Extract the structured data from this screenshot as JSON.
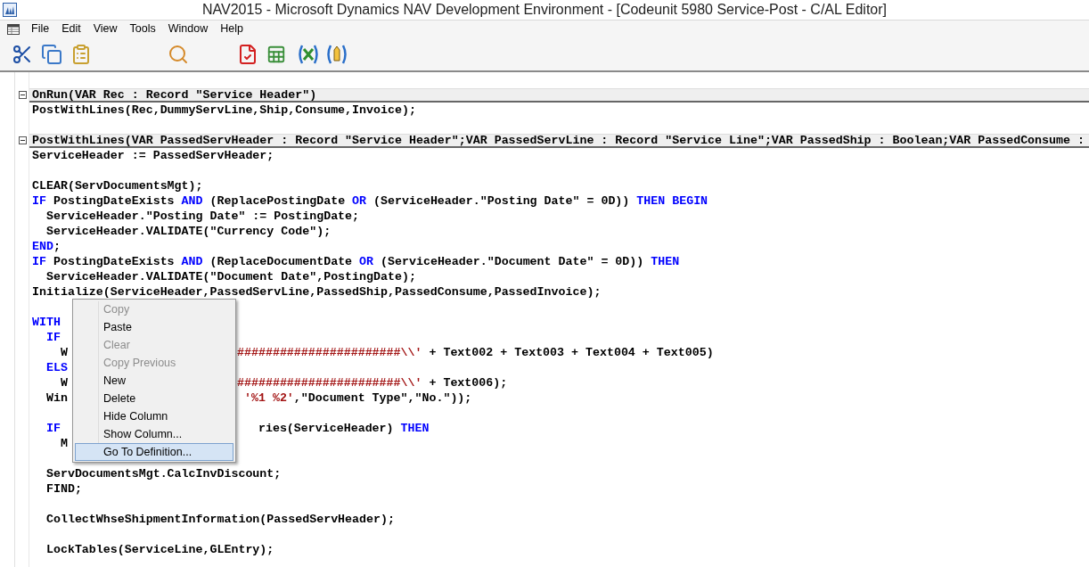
{
  "window": {
    "title": "NAV2015 - Microsoft Dynamics NAV Development Environment - [Codeunit 5980 Service-Post - C/AL Editor]"
  },
  "menu_bar": [
    "File",
    "Edit",
    "View",
    "Tools",
    "Window",
    "Help"
  ],
  "editor": {
    "lines": [
      {
        "kind": "header",
        "expanded": true,
        "text": "OnRun(VAR Rec : Record \"Service Header\")"
      },
      {
        "kind": "code",
        "parts": [
          {
            "kind": "plain",
            "text": "PostWithLines(Rec,DummyServLine,Ship,Consume,Invoice);"
          }
        ]
      },
      {
        "kind": "blank"
      },
      {
        "kind": "header",
        "expanded": true,
        "text": "PostWithLines(VAR PassedServHeader : Record \"Service Header\";VAR PassedServLine : Record \"Service Line\";VAR PassedShip : Boolean;VAR PassedConsume :"
      },
      {
        "kind": "code",
        "parts": [
          {
            "kind": "plain",
            "text": "ServiceHeader := PassedServHeader;"
          }
        ]
      },
      {
        "kind": "blank"
      },
      {
        "kind": "code",
        "parts": [
          {
            "kind": "plain",
            "text": "CLEAR(ServDocumentsMgt);"
          }
        ]
      },
      {
        "kind": "code",
        "parts": [
          {
            "kind": "keyword",
            "text": "IF"
          },
          {
            "kind": "plain",
            "text": " PostingDateExists "
          },
          {
            "kind": "keyword",
            "text": "AND"
          },
          {
            "kind": "plain",
            "text": " (ReplacePostingDate "
          },
          {
            "kind": "keyword",
            "text": "OR"
          },
          {
            "kind": "plain",
            "text": " (ServiceHeader.\"Posting Date\" = 0D)) "
          },
          {
            "kind": "keyword",
            "text": "THEN BEGIN"
          }
        ]
      },
      {
        "kind": "code",
        "parts": [
          {
            "kind": "plain",
            "text": "  ServiceHeader.\"Posting Date\" := PostingDate;"
          }
        ]
      },
      {
        "kind": "code",
        "parts": [
          {
            "kind": "plain",
            "text": "  ServiceHeader.VALIDATE(\"Currency Code\");"
          }
        ]
      },
      {
        "kind": "code",
        "parts": [
          {
            "kind": "keyword",
            "text": "END"
          },
          {
            "kind": "plain",
            "text": ";"
          }
        ]
      },
      {
        "kind": "code",
        "parts": [
          {
            "kind": "keyword",
            "text": "IF"
          },
          {
            "kind": "plain",
            "text": " PostingDateExists "
          },
          {
            "kind": "keyword",
            "text": "AND"
          },
          {
            "kind": "plain",
            "text": " (ReplaceDocumentDate "
          },
          {
            "kind": "keyword",
            "text": "OR"
          },
          {
            "kind": "plain",
            "text": " (ServiceHeader.\"Document Date\" = 0D)) "
          },
          {
            "kind": "keyword",
            "text": "THEN"
          }
        ]
      },
      {
        "kind": "code",
        "parts": [
          {
            "kind": "plain",
            "text": "  ServiceHeader.VALIDATE(\"Document Date\",PostingDate);"
          }
        ]
      },
      {
        "kind": "code",
        "parts": [
          {
            "kind": "plain",
            "text": "Initialize(ServiceHeader,PassedServLine,PassedShip,PassedConsume,PassedInvoice);"
          }
        ]
      },
      {
        "kind": "blank"
      },
      {
        "kind": "code",
        "parts": [
          {
            "kind": "keyword",
            "text": "WITH"
          }
        ]
      },
      {
        "kind": "code",
        "parts": [
          {
            "kind": "keyword",
            "text": "  IF"
          }
        ]
      },
      {
        "kind": "code",
        "parts": [
          {
            "kind": "plain",
            "text": "    W"
          }
        ],
        "after_menu": [
          {
            "kind": "string",
            "text": "#######################\\\\'"
          },
          {
            "kind": "plain",
            "text": " + Text002 + Text003 + Text004 + Text005)"
          }
        ]
      },
      {
        "kind": "code",
        "parts": [
          {
            "kind": "keyword",
            "text": "  ELS"
          }
        ]
      },
      {
        "kind": "code",
        "parts": [
          {
            "kind": "plain",
            "text": "    W"
          }
        ],
        "after_menu": [
          {
            "kind": "string",
            "text": "#######################\\\\'"
          },
          {
            "kind": "plain",
            "text": " + Text006);"
          }
        ]
      },
      {
        "kind": "code",
        "parts": [
          {
            "kind": "plain",
            "text": "  Win"
          }
        ],
        "after_menu": [
          {
            "kind": "string",
            "text": " '%1 %2'"
          },
          {
            "kind": "plain",
            "text": ",\"Document Type\",\"No.\"));"
          }
        ]
      },
      {
        "kind": "blank"
      },
      {
        "kind": "code",
        "parts": [
          {
            "kind": "keyword",
            "text": "  IF"
          }
        ],
        "after_menu": [
          {
            "kind": "plain",
            "text": "   ries(ServiceHeader) "
          },
          {
            "kind": "keyword",
            "text": "THEN"
          }
        ]
      },
      {
        "kind": "code",
        "parts": [
          {
            "kind": "plain",
            "text": "    M"
          }
        ]
      },
      {
        "kind": "blank"
      },
      {
        "kind": "code",
        "parts": [
          {
            "kind": "plain",
            "text": "  ServDocumentsMgt.CalcInvDiscount;"
          }
        ]
      },
      {
        "kind": "code",
        "parts": [
          {
            "kind": "plain",
            "text": "  FIND;"
          }
        ]
      },
      {
        "kind": "blank"
      },
      {
        "kind": "code",
        "parts": [
          {
            "kind": "plain",
            "text": "  CollectWhseShipmentInformation(PassedServHeader);"
          }
        ]
      },
      {
        "kind": "blank"
      },
      {
        "kind": "code",
        "parts": [
          {
            "kind": "plain",
            "text": "  LockTables(ServiceLine,GLEntry);"
          }
        ]
      }
    ]
  },
  "context_menu": [
    {
      "label": "Copy",
      "disabled": true,
      "selected": false
    },
    {
      "label": "Paste",
      "disabled": false,
      "selected": false
    },
    {
      "label": "Clear",
      "disabled": true,
      "selected": false
    },
    {
      "label": "Copy Previous",
      "disabled": true,
      "selected": false
    },
    {
      "label": "New",
      "disabled": false,
      "selected": false
    },
    {
      "label": "Delete",
      "disabled": false,
      "selected": false
    },
    {
      "label": "Hide Column",
      "disabled": false,
      "selected": false
    },
    {
      "label": "Show Column...",
      "disabled": false,
      "selected": false
    },
    {
      "label": "Go To Definition...",
      "disabled": false,
      "selected": true
    }
  ]
}
